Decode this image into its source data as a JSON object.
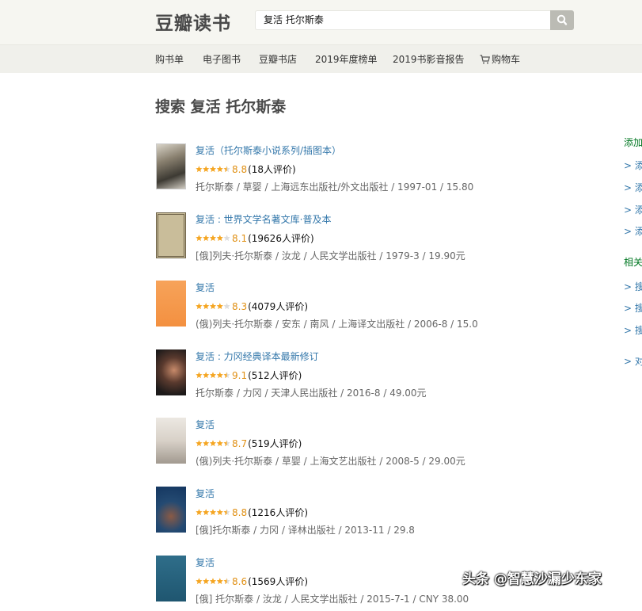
{
  "header": {
    "logo": "豆瓣读书",
    "search_value": "复活  托尔斯泰"
  },
  "nav": {
    "items": [
      "购书单",
      "电子图书",
      "豆瓣书店",
      "2019年度榜单",
      "2019书影音报告"
    ],
    "cart": "购物车"
  },
  "page_title": "搜索 复活 托尔斯泰",
  "results": [
    {
      "title": "复活（托尔斯泰小说系列/插图本）",
      "score": "8.8",
      "votes": "(18人评价)",
      "meta": "托尔斯泰 / 草婴 / 上海远东出版社/外文出版社 / 1997-01 / 15.80",
      "stars": 4.5
    },
    {
      "title": "复活 : 世界文学名著文库·普及本",
      "score": "8.1",
      "votes": "(19626人评价)",
      "meta": "[俄]列夫·托尔斯泰 / 汝龙 / 人民文学出版社 / 1979-3 / 19.90元",
      "stars": 4
    },
    {
      "title": "复活",
      "score": "8.3",
      "votes": "(4079人评价)",
      "meta": "(俄)列夫·托尔斯泰 / 安东 / 南风 / 上海译文出版社 / 2006-8 / 15.0",
      "stars": 4
    },
    {
      "title": "复活 : 力冈经典译本最新修订",
      "score": "9.1",
      "votes": "(512人评价)",
      "meta": "托尔斯泰 / 力冈 / 天津人民出版社 / 2016-8 / 49.00元",
      "stars": 4.5
    },
    {
      "title": "复活",
      "score": "8.7",
      "votes": "(519人评价)",
      "meta": "(俄)列夫·托尔斯泰 / 草婴 / 上海文艺出版社 / 2008-5 / 29.00元",
      "stars": 4.5
    },
    {
      "title": "复活",
      "score": "8.8",
      "votes": "(1216人评价)",
      "meta": "[俄]托尔斯泰 / 力冈 / 译林出版社 / 2013-11 / 29.8",
      "stars": 4.5
    },
    {
      "title": "复活",
      "score": "8.6",
      "votes": "(1569人评价)",
      "meta": "[俄] 托尔斯泰 / 汝龙 / 人民文学出版社 / 2015-7-1 / CNY 38.00",
      "stars": 4.5
    }
  ],
  "sidebar": {
    "heading1": "添加",
    "links1": [
      "> 添",
      "> 添",
      "> 添",
      "> 添"
    ],
    "heading2": "相关",
    "links2": [
      "> 搜",
      "> 搜",
      "> 搜"
    ],
    "link3": "> 对"
  },
  "watermark": "头条 @智慧沙漏少东家",
  "colors": {
    "link": "#3377aa",
    "score": "#e09015",
    "sidebar_heading": "#007722",
    "topbar_bg": "#f6f6f1",
    "navbar_bg": "#f0f0eb"
  }
}
